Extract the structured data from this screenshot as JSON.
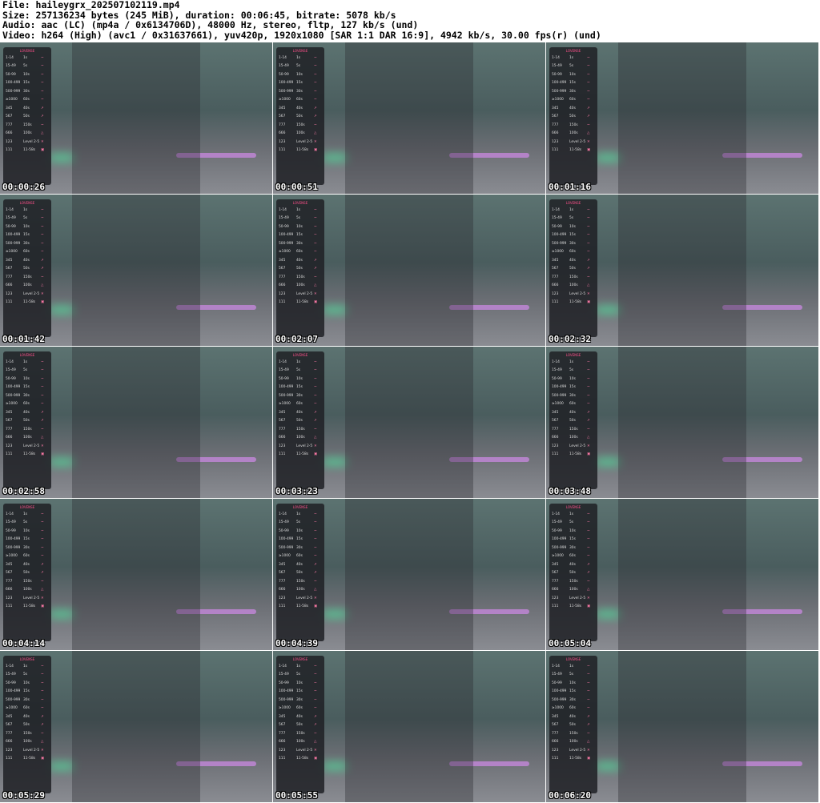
{
  "header": {
    "file": "File: haileygrx_202507102119.mp4",
    "size": "Size: 257136234 bytes (245 MiB), duration: 00:06:45, bitrate: 5078 kb/s",
    "audio": "Audio: aac (LC) (mp4a / 0x6134706D), 48000 Hz, stereo, fltp, 127 kb/s (und)",
    "video": "Video: h264 (High) (avc1 / 0x31637661), yuv420p, 1920x1080 [SAR 1:1 DAR 16:9], 4942 kb/s, 30.00 fps(r) (und)"
  },
  "panel": {
    "brand": "LOVENSE",
    "rows": [
      [
        "1-14",
        "1s",
        "~"
      ],
      [
        "15-49",
        "5s",
        "~"
      ],
      [
        "50-99",
        "10s",
        "~"
      ],
      [
        "100-499",
        "15s",
        "~"
      ],
      [
        "500-999",
        "30s",
        "~"
      ],
      [
        "≥1000",
        "60s",
        "~"
      ],
      [
        "345",
        "40s",
        "↗"
      ],
      [
        "567",
        "50s",
        "↗"
      ],
      [
        "777",
        "150s",
        "~"
      ],
      [
        "666",
        "100s",
        "△"
      ],
      [
        "123",
        "Level 2-5",
        "✕"
      ],
      [
        "111",
        "11-58s",
        "▣"
      ]
    ]
  },
  "thumbnails": [
    {
      "time": "00:00:26"
    },
    {
      "time": "00:00:51"
    },
    {
      "time": "00:01:16"
    },
    {
      "time": "00:01:42"
    },
    {
      "time": "00:02:07"
    },
    {
      "time": "00:02:32"
    },
    {
      "time": "00:02:58"
    },
    {
      "time": "00:03:23"
    },
    {
      "time": "00:03:48"
    },
    {
      "time": "00:04:14"
    },
    {
      "time": "00:04:39"
    },
    {
      "time": "00:05:04"
    },
    {
      "time": "00:05:29"
    },
    {
      "time": "00:05:55"
    },
    {
      "time": "00:06:20"
    }
  ]
}
